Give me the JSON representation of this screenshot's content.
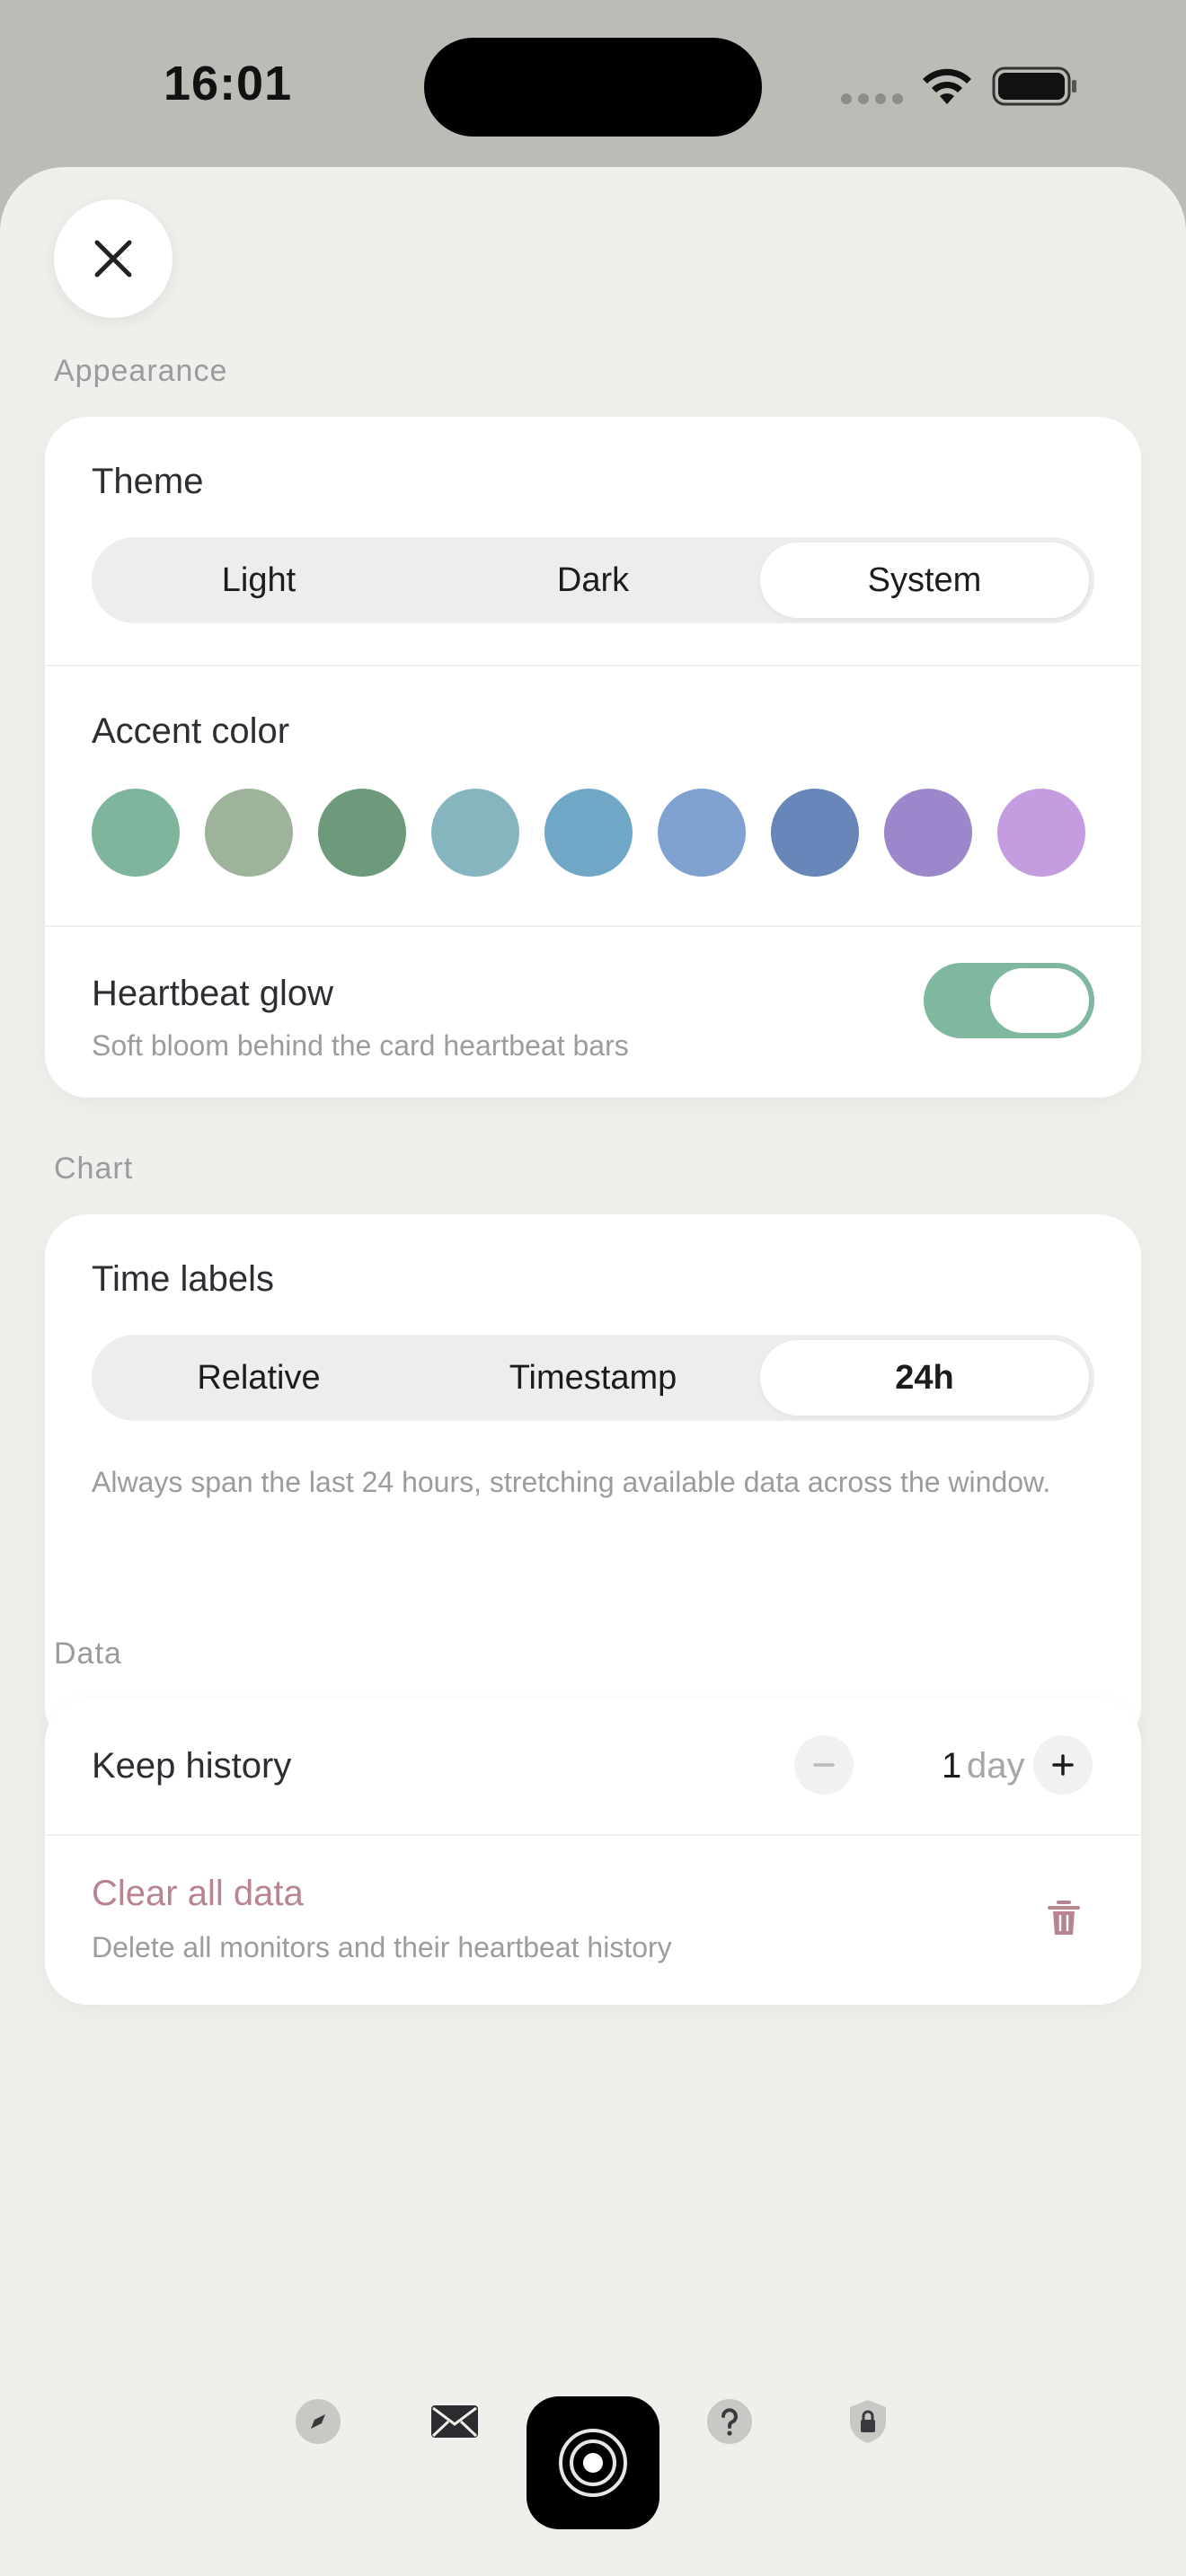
{
  "status_bar": {
    "time": "16:01"
  },
  "appearance": {
    "section_label": "Appearance",
    "theme": {
      "label": "Theme",
      "options": [
        "Light",
        "Dark",
        "System"
      ],
      "selected": "System"
    },
    "accent": {
      "label": "Accent color",
      "colors": [
        "#7fb59d",
        "#9db39a",
        "#6d9a7b",
        "#86b5bf",
        "#71a7c6",
        "#7fa2d1",
        "#6886b8",
        "#9b87c9",
        "#c59ce0"
      ]
    },
    "heartbeat": {
      "title": "Heartbeat glow",
      "subtitle": "Soft bloom behind the card heartbeat bars",
      "enabled": true
    }
  },
  "chart": {
    "section_label": "Chart",
    "time_labels": {
      "label": "Time labels",
      "options": [
        "Relative",
        "Timestamp",
        "24h"
      ],
      "selected": "24h",
      "description": "Always span the last 24 hours, stretching available data across the window."
    }
  },
  "data": {
    "section_label": "Data",
    "keep_history": {
      "label": "Keep history",
      "value": "1",
      "unit": "day"
    },
    "clear": {
      "title": "Clear all data",
      "subtitle": "Delete all monitors and their heartbeat history"
    }
  },
  "colors": {
    "toggle_on": "#7fb79f",
    "destructive": "#b8848e"
  },
  "footer_icons": [
    "compass-icon",
    "mail-icon",
    "star-bubble-icon",
    "help-icon",
    "privacy-shield-icon"
  ]
}
